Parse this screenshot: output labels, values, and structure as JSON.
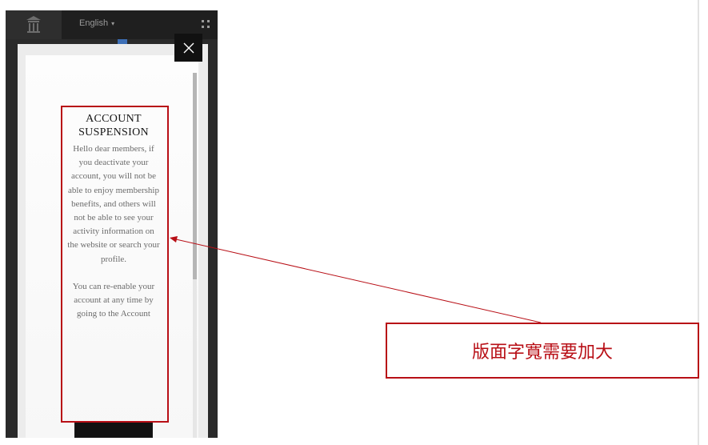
{
  "topbar": {
    "language": "English",
    "language_caret": "▾"
  },
  "modal": {
    "close_glyph": "×",
    "title": "ACCOUNT SUSPENSION",
    "paragraphs": [
      "Hello dear members, if you deactivate your account, you will not be able to enjoy membership benefits, and others will not be able to see your activity information on the website or search your profile.",
      "You can re-enable your account at any time by going to the Account"
    ]
  },
  "annotation": {
    "note": "版面字寬需要加大",
    "color": "#b80f16"
  },
  "icons": {
    "logo": "temple-logo-icon",
    "menu": "grid-menu-icon",
    "close": "close-icon",
    "chevron": "chevron-down-icon"
  }
}
